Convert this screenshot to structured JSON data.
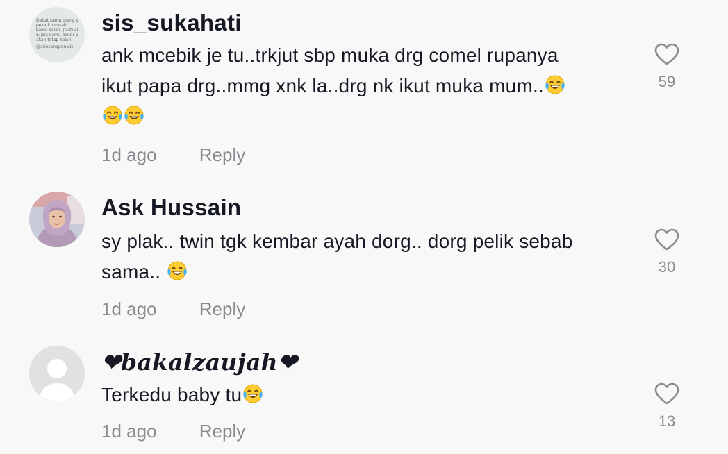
{
  "comments": [
    {
      "username": "sis_sukahati",
      "avatar": {
        "kind": "text-image",
        "lines": [
          "Debat sama orang yg kurang",
          "peka itu susah.",
          "kamu salah, pasti akan kalah",
          "& jika kamu benar pun kau",
          "akan tetap kalah!"
        ],
        "tag": "@ariesangpenulis"
      },
      "text_line1": "ank mcebik je tu..trkjut sbp muka drg comel rupanya",
      "text_line2": "ikut papa drg..mmg xnk la..drg nk ikut muka mum..",
      "emoji": "laughing-tears-emoji",
      "time": "1d ago",
      "reply_label": "Reply",
      "like_count": "59"
    },
    {
      "username": "Ask Hussain",
      "avatar": {
        "kind": "photo"
      },
      "text_line1": "sy plak.. twin tgk kembar ayah dorg.. dorg pelik sebab",
      "text_line2": "sama.. ",
      "emoji": "laughing-tears-emoji",
      "time": "1d ago",
      "reply_label": "Reply",
      "like_count": "30"
    },
    {
      "username": "❤𝒃𝒂𝒌𝒂𝒍𝒛𝒂𝒖𝒋𝒂𝒉❤",
      "avatar": {
        "kind": "default"
      },
      "text_line1": "Terkedu baby tu",
      "emoji": "laughing-tears-emoji",
      "time": "1d ago",
      "reply_label": "Reply",
      "like_count": "13"
    }
  ],
  "colors": {
    "background": "#f8f8f8",
    "text_primary": "#161823",
    "text_secondary": "#8a8b91",
    "emoji_face": "#ffcc33"
  }
}
